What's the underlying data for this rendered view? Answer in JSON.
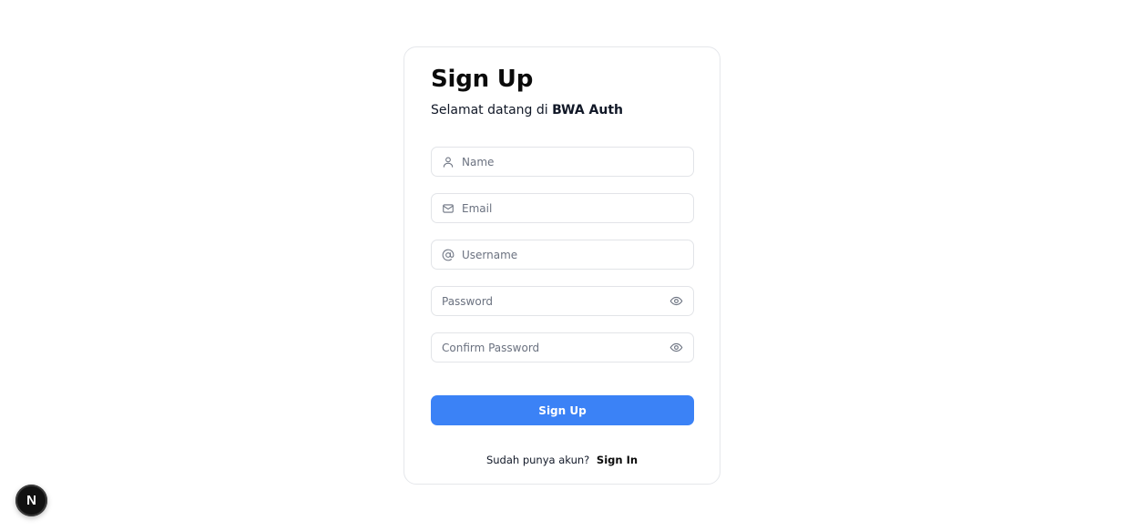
{
  "form": {
    "title": "Sign Up",
    "subtitle_prefix": "Selamat datang di ",
    "subtitle_brand": "BWA Auth",
    "fields": {
      "name": {
        "placeholder": "Name",
        "value": "",
        "icon": "user-icon"
      },
      "email": {
        "placeholder": "Email",
        "value": "",
        "icon": "mail-icon"
      },
      "username": {
        "placeholder": "Username",
        "value": "",
        "icon": "at-sign-icon"
      },
      "password": {
        "placeholder": "Password",
        "value": "",
        "icon": "eye-icon"
      },
      "confirm_password": {
        "placeholder": "Confirm Password",
        "value": "",
        "icon": "eye-icon"
      }
    },
    "submit_label": "Sign Up",
    "footer_text": "Sudah punya akun?",
    "footer_link": "Sign In"
  },
  "dev_badge": {
    "label": "N",
    "icon": "nextjs-logo-icon"
  },
  "colors": {
    "primary": "#3b82f6",
    "border": "#e2e4e8",
    "text": "#111827",
    "placeholder": "#6b7280"
  }
}
